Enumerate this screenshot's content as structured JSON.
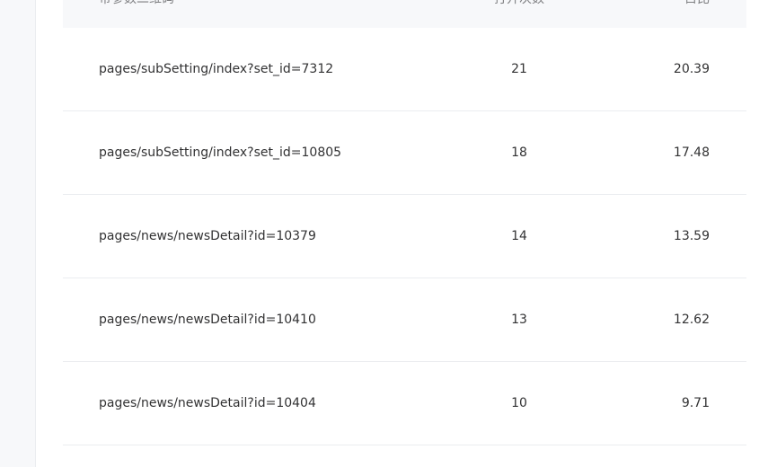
{
  "table": {
    "headers": [
      "带参数二维码",
      "打开次数",
      "占比"
    ],
    "rows": [
      {
        "path": "pages/subSetting/index?set_id=7312",
        "count": "21",
        "ratio": "20.39"
      },
      {
        "path": "pages/subSetting/index?set_id=10805",
        "count": "18",
        "ratio": "17.48"
      },
      {
        "path": "pages/news/newsDetail?id=10379",
        "count": "14",
        "ratio": "13.59"
      },
      {
        "path": "pages/news/newsDetail?id=10410",
        "count": "13",
        "ratio": "12.62"
      },
      {
        "path": "pages/news/newsDetail?id=10404",
        "count": "10",
        "ratio": "9.71"
      }
    ]
  }
}
